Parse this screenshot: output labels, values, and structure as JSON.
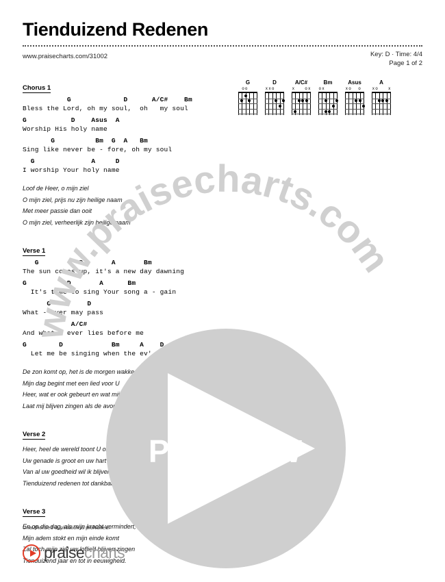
{
  "document": {
    "title": "Tienduizend Redenen",
    "url": "www.praisecharts.com/31002",
    "key_time": "Key: D · Time: 4/4",
    "page_indicator": "Page 1 of 2",
    "footer_notice": "Unauthorized duplication is prohibited."
  },
  "chord_diagrams": [
    {
      "name": "G",
      "markers": [
        "",
        "o",
        "o",
        "",
        "",
        ""
      ],
      "dots": [
        [
          1,
          2
        ],
        [
          2,
          3
        ],
        [
          2,
          1
        ]
      ]
    },
    {
      "name": "D",
      "markers": [
        "x",
        "x",
        "o",
        "",
        "",
        ""
      ],
      "dots": [
        [
          2,
          3
        ],
        [
          2,
          5
        ],
        [
          3,
          4
        ]
      ]
    },
    {
      "name": "A/C#",
      "markers": [
        "x",
        "",
        "",
        "",
        "o",
        "x"
      ],
      "dots": [
        [
          2,
          2
        ],
        [
          2,
          3
        ],
        [
          2,
          4
        ],
        [
          4,
          1
        ]
      ]
    },
    {
      "name": "Bm",
      "markers": [
        "o",
        "x",
        "",
        "",
        "",
        ""
      ],
      "dots": [
        [
          2,
          2
        ],
        [
          2,
          5
        ],
        [
          3,
          4
        ],
        [
          4,
          3
        ],
        [
          4,
          2
        ]
      ]
    },
    {
      "name": "Asus",
      "markers": [
        "x",
        "o",
        "",
        "",
        "o",
        ""
      ],
      "dots": [
        [
          2,
          3
        ],
        [
          2,
          4
        ],
        [
          3,
          5
        ]
      ]
    },
    {
      "name": "A",
      "markers": [
        "x",
        "o",
        "",
        "",
        "",
        "x"
      ],
      "dots": [
        [
          2,
          2
        ],
        [
          2,
          3
        ],
        [
          2,
          4
        ]
      ]
    }
  ],
  "sections": [
    {
      "heading": "Chorus 1",
      "lines": [
        {
          "chords": "           G             D      A/C#    Bm",
          "lyrics": "Bless the Lord, oh my soul,  oh   my soul"
        },
        {
          "chords": "G           D    Asus  A",
          "lyrics": "Worship His holy name"
        },
        {
          "chords": "       G          Bm  G  A   Bm",
          "lyrics": "Sing like never be - fore, oh my soul"
        },
        {
          "chords": "  G              A     D",
          "lyrics": "I worship Your holy name"
        }
      ],
      "translation": [
        "Loof de Heer, o mijn ziel",
        "O mijn ziel, prijs nu zijn heilige naam",
        "Met meer passie dan ooit",
        "O mijn ziel, verheerlijk zijn heilige naam"
      ]
    },
    {
      "heading": "Verse 1",
      "lines": [
        {
          "chords": "   G          D       A       Bm",
          "lyrics": "The sun comes up, it's a new day dawning"
        },
        {
          "chords": "G          D       A      Bm",
          "lyrics": "  It's time to sing Your song a - gain"
        },
        {
          "chords": "      G         D",
          "lyrics": "What - ever may pass"
        },
        {
          "chords": "            A/C#",
          "lyrics": "And what - ever lies before me"
        },
        {
          "chords": "G        D            Bm     A    D",
          "lyrics": "  Let me be singing when the ev' - ning comes"
        }
      ],
      "translation": [
        "De zon komt op, het is de morgen wakker",
        "Mijn dag begint met een lied voor U",
        "Heer, wat er ook gebeurt en wat mij mag overkomen",
        "Laat mij blijven zingen als de avond valt"
      ]
    },
    {
      "heading": "Verse 2",
      "lines": [],
      "translation": [
        "Heer, heel de wereld toont U ons uw liefde.",
        "Uw genade is groot en uw hart is zacht.",
        "Van al uw goedheid wil ik blijven zingen",
        "Tienduizend redenen tot dankbaarheid."
      ]
    },
    {
      "heading": "Verse 3",
      "lines": [],
      "translation": [
        "En op die dag, als mijn kracht vermindert,",
        "Mijn adem stokt en mijn einde komt",
        "Zal toch mijn ziel uw loflied blijven zingen",
        "Tienduizend jaar en tot in eeuwigheid."
      ]
    }
  ],
  "watermark": {
    "circular_text": "www.praisecharts.com",
    "preview_label": "PREVIEW"
  },
  "logo": {
    "text_dark": "praise",
    "text_light": "charts",
    "accent_color": "#e23b26"
  }
}
